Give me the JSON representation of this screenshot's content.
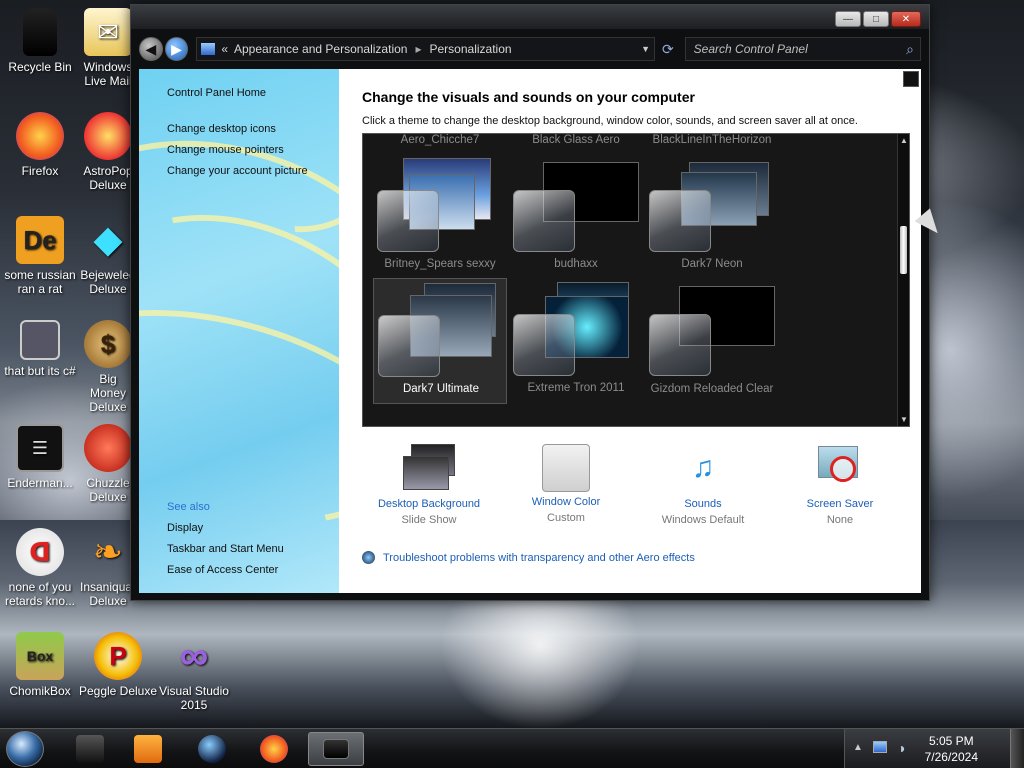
{
  "desktop": {
    "icons": [
      {
        "label": "Recycle Bin"
      },
      {
        "label": "Windows Live Mail"
      },
      {
        "label": "Firefox"
      },
      {
        "label": "AstroPop Deluxe"
      },
      {
        "label": "some russian ran a rat"
      },
      {
        "label": "Bejeweled Deluxe"
      },
      {
        "label": "that but its c#"
      },
      {
        "label": "Big Money Deluxe"
      },
      {
        "label": "Enderman..."
      },
      {
        "label": "Chuzzle Deluxe"
      },
      {
        "label": "none of you retards kno..."
      },
      {
        "label": "Insaniquarium Deluxe"
      },
      {
        "label": "ChomikBox"
      },
      {
        "label": "Peggle Deluxe"
      },
      {
        "label": "Visual Studio 2015"
      }
    ]
  },
  "window": {
    "buttons": {
      "minimize": "—",
      "maximize": "□",
      "close": "✕"
    },
    "breadcrumb": {
      "prefix": "«",
      "parent": "Appearance and Personalization",
      "separator": "▸",
      "current": "Personalization"
    },
    "search": {
      "placeholder": "Search Control Panel"
    }
  },
  "left_pane": {
    "links": [
      "Control Panel Home",
      "Change desktop icons",
      "Change mouse pointers",
      "Change your account picture"
    ],
    "see_also_label": "See also",
    "see_also": [
      "Display",
      "Taskbar and Start Menu",
      "Ease of Access Center"
    ]
  },
  "main": {
    "title": "Change the visuals and sounds on your computer",
    "description": "Click a theme to change the desktop background, window color, sounds, and screen saver all at once.",
    "top_row_names": [
      "Aero_Chicche7",
      "Black Glass Aero",
      "BlackLineInTheHorizon"
    ],
    "themes": [
      {
        "name": "Britney_Spears sexxy",
        "selected": false
      },
      {
        "name": "budhaxx",
        "selected": false
      },
      {
        "name": "Dark7 Neon",
        "selected": false
      },
      {
        "name": "Dark7 Ultimate",
        "selected": true
      },
      {
        "name": "Extreme Tron 2011",
        "selected": false
      },
      {
        "name": "Gizdom Reloaded Clear",
        "selected": false
      }
    ],
    "settings": [
      {
        "title": "Desktop Background",
        "value": "Slide Show",
        "icon": "desktop-background-icon"
      },
      {
        "title": "Window Color",
        "value": "Custom",
        "icon": "window-color-icon"
      },
      {
        "title": "Sounds",
        "value": "Windows Default",
        "icon": "sounds-icon"
      },
      {
        "title": "Screen Saver",
        "value": "None",
        "icon": "screen-saver-icon"
      }
    ],
    "troubleshoot": "Troubleshoot problems with transparency and other Aero effects"
  },
  "taskbar": {
    "time": "5:05 PM",
    "date": "7/26/2024",
    "tray_arrow": "▲"
  }
}
